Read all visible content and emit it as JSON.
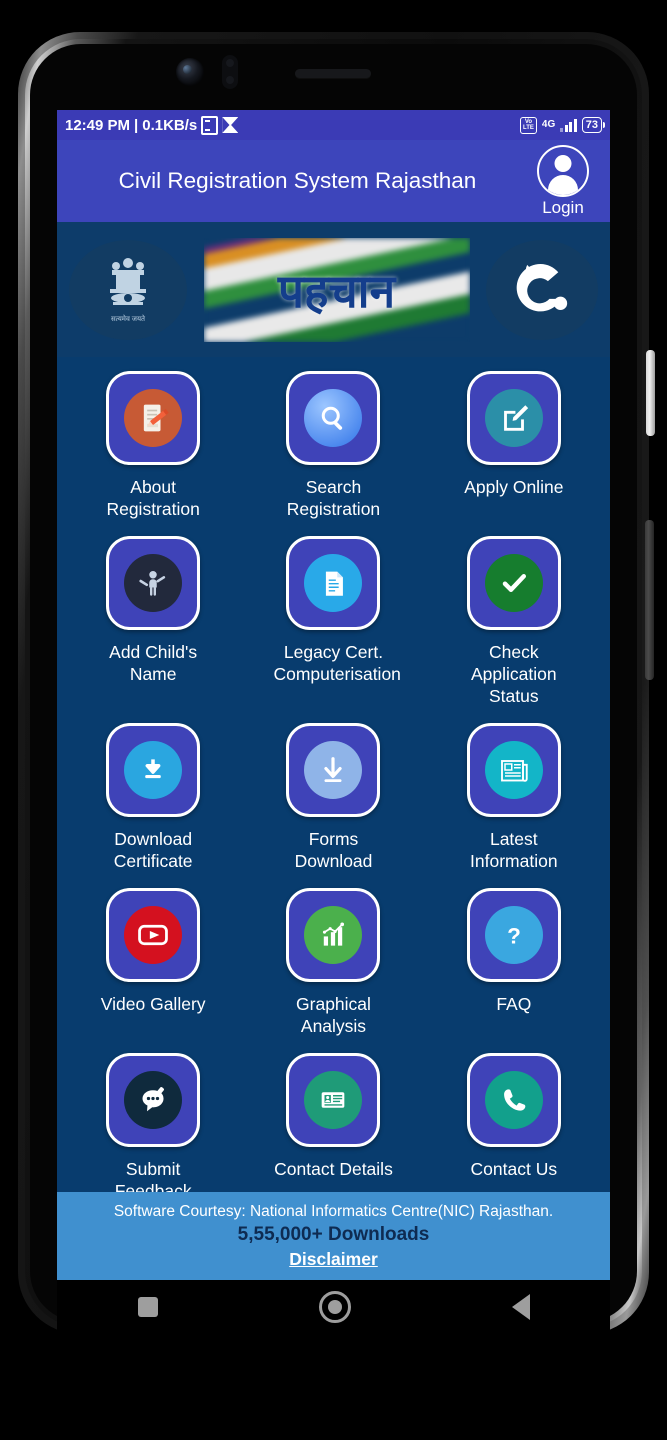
{
  "status_bar": {
    "time": "12:49 PM",
    "separator": "|",
    "network_speed": "0.1KB/s",
    "doc_icon": "document-icon",
    "sync_icon": "sync-icon",
    "volte_label": "VoLTE",
    "volte_line1": "Vo",
    "volte_line2": "LTE",
    "network_type": "4G",
    "signal_icon": "signal-bars-icon",
    "battery_level": "73"
  },
  "app_bar": {
    "title": "Civil Registration System Rajasthan",
    "login_label": "Login",
    "avatar_icon": "user-avatar-icon",
    "bg_color": "#3d45bb"
  },
  "banner": {
    "emblem_name": "india-national-emblem",
    "emblem_motto": "सत्यमेव जयते",
    "flag_text": "पहचान",
    "pehchan_logo_name": "pehchan-logo"
  },
  "grid": {
    "items": [
      {
        "label": "About Registration",
        "icon": "document-pencil-icon",
        "badge": "bg-orange"
      },
      {
        "label": "Search Registration",
        "icon": "magnifier-icon",
        "badge": "bg-bluegrad"
      },
      {
        "label": "Apply Online",
        "icon": "compose-edit-icon",
        "badge": "bg-teal"
      },
      {
        "label": "Add Child's Name",
        "icon": "child-icon",
        "badge": "bg-dark"
      },
      {
        "label": "Legacy Cert. Computerisation",
        "icon": "certificate-icon",
        "badge": "bg-lightblue"
      },
      {
        "label": "Check Application Status",
        "icon": "checkmark-circle-icon",
        "badge": "bg-green"
      },
      {
        "label": "Download Certificate",
        "icon": "download-tray-icon",
        "badge": "bg-cyanblue"
      },
      {
        "label": "Forms Download",
        "icon": "download-arrow-icon",
        "badge": "bg-paleblue"
      },
      {
        "label": "Latest Information",
        "icon": "newspaper-icon",
        "badge": "bg-cyan"
      },
      {
        "label": "Video Gallery",
        "icon": "video-play-icon",
        "badge": "bg-red"
      },
      {
        "label": "Graphical Analysis",
        "icon": "bar-chart-icon",
        "badge": "bg-limegreen"
      },
      {
        "label": "FAQ",
        "icon": "question-mark-icon",
        "badge": "bg-skyblue"
      },
      {
        "label": "Submit Feedback",
        "icon": "feedback-chat-icon",
        "badge": "bg-navy"
      },
      {
        "label": "Contact Details",
        "icon": "id-card-icon",
        "badge": "bg-seagreen"
      },
      {
        "label": "Contact Us",
        "icon": "phone-icon",
        "badge": "bg-teal2"
      }
    ]
  },
  "footer": {
    "courtesy": "Software Courtesy: National Informatics Centre(NIC) Rajasthan.",
    "downloads": "5,55,000+ Downloads",
    "disclaimer": "Disclaimer",
    "bg_color": "#4090cf"
  },
  "nav_bar": {
    "recents_icon": "recents-square-icon",
    "home_icon": "home-circle-icon",
    "back_icon": "back-triangle-icon"
  }
}
